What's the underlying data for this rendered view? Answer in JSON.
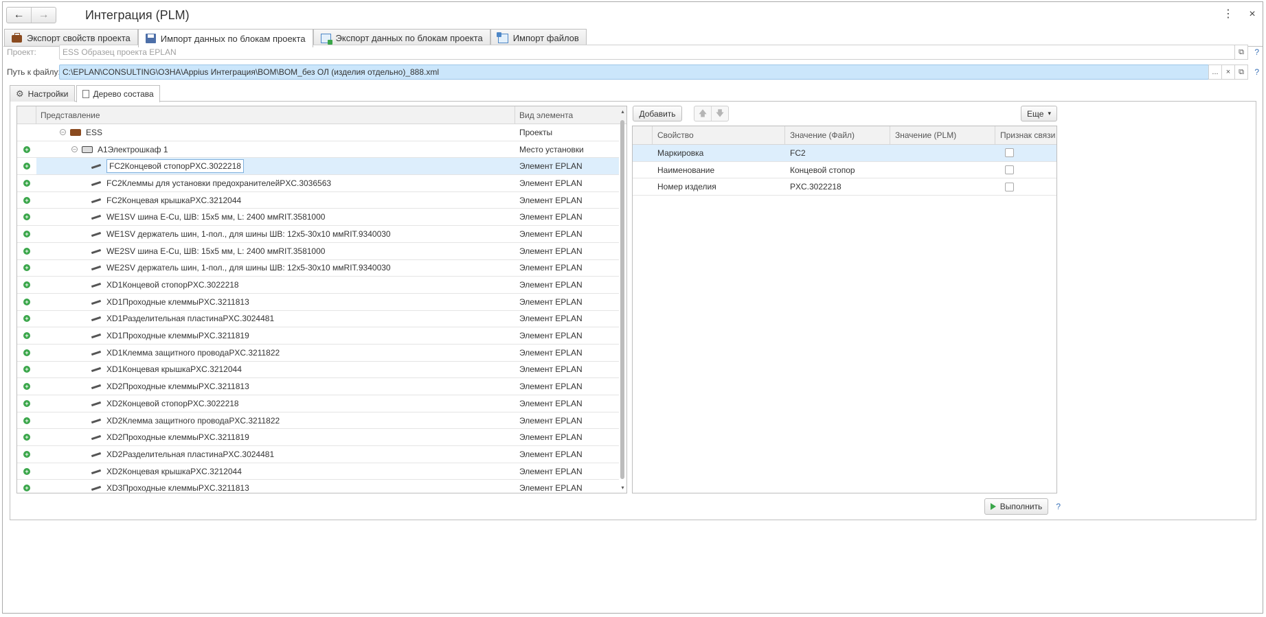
{
  "window": {
    "title": "Интеграция (PLM)",
    "nav_back": "←",
    "nav_forward": "→",
    "menu_glyph": "⋮",
    "close_glyph": "×"
  },
  "top_tabs": [
    {
      "label": "Экспорт свойств проекта",
      "icon": "briefcase-icon"
    },
    {
      "label": "Импорт данных по блокам проекта",
      "icon": "disk-icon",
      "active": true
    },
    {
      "label": "Экспорт данных по блокам проекта",
      "icon": "export-icon"
    },
    {
      "label": "Импорт файлов",
      "icon": "import-icon"
    }
  ],
  "fields": {
    "project": {
      "label": "Проект:",
      "value": "ESS Образец проекта EPLAN"
    },
    "path": {
      "label": "Путь к файлу:",
      "value": "C:\\EPLAN\\CONSULTING\\ОЗНА\\Appius Интеграция\\BOM\\BOM_без ОЛ (изделия отдельно)_888.xml"
    },
    "help": "?",
    "ellipsis": "...",
    "clear": "×",
    "open": "⧉"
  },
  "inner_tabs": [
    {
      "label": "Настройки",
      "icon": "gear-icon"
    },
    {
      "label": "Дерево состава",
      "icon": "tree-icon",
      "active": true
    }
  ],
  "tree": {
    "headers": {
      "presentation": "Представление",
      "type": "Вид элемента"
    },
    "rows": [
      {
        "level": 0,
        "toggle": "minus",
        "plus": false,
        "icon": "briefcase",
        "text": "ESS",
        "type": "Проекты"
      },
      {
        "level": 1,
        "toggle": "minus",
        "plus": true,
        "icon": "cabinet",
        "text": "A1Электрошкаф 1",
        "type": "Место установки"
      },
      {
        "level": 2,
        "plus": true,
        "icon": "element",
        "text": "FC2Концевой стопорPXC.3022218",
        "type": "Элемент EPLAN",
        "selected": true
      },
      {
        "level": 2,
        "plus": true,
        "icon": "element",
        "text": "FC2Клеммы для установки предохранителейPXC.3036563",
        "type": "Элемент EPLAN"
      },
      {
        "level": 2,
        "plus": true,
        "icon": "element",
        "text": "FC2Концевая крышкаPXC.3212044",
        "type": "Элемент EPLAN"
      },
      {
        "level": 2,
        "plus": true,
        "icon": "element",
        "text": "WE1SV шина E-Cu, ШВ: 15x5 мм, L: 2400 ммRIT.3581000",
        "type": "Элемент EPLAN"
      },
      {
        "level": 2,
        "plus": true,
        "icon": "element",
        "text": "WE1SV держатель шин, 1-пол., для шины ШВ: 12x5-30x10 ммRIT.9340030",
        "type": "Элемент EPLAN"
      },
      {
        "level": 2,
        "plus": true,
        "icon": "element",
        "text": "WE2SV шина E-Cu, ШВ: 15x5 мм, L: 2400 ммRIT.3581000",
        "type": "Элемент EPLAN"
      },
      {
        "level": 2,
        "plus": true,
        "icon": "element",
        "text": "WE2SV держатель шин, 1-пол., для шины ШВ: 12x5-30x10 ммRIT.9340030",
        "type": "Элемент EPLAN"
      },
      {
        "level": 2,
        "plus": true,
        "icon": "element",
        "text": "XD1Концевой стопорPXC.3022218",
        "type": "Элемент EPLAN"
      },
      {
        "level": 2,
        "plus": true,
        "icon": "element",
        "text": "XD1Проходные клеммыPXC.3211813",
        "type": "Элемент EPLAN"
      },
      {
        "level": 2,
        "plus": true,
        "icon": "element",
        "text": "XD1Разделительная пластинаPXC.3024481",
        "type": "Элемент EPLAN"
      },
      {
        "level": 2,
        "plus": true,
        "icon": "element",
        "text": "XD1Проходные клеммыPXC.3211819",
        "type": "Элемент EPLAN"
      },
      {
        "level": 2,
        "plus": true,
        "icon": "element",
        "text": "XD1Клемма защитного проводаPXC.3211822",
        "type": "Элемент EPLAN"
      },
      {
        "level": 2,
        "plus": true,
        "icon": "element",
        "text": "XD1Концевая крышкаPXC.3212044",
        "type": "Элемент EPLAN"
      },
      {
        "level": 2,
        "plus": true,
        "icon": "element",
        "text": "XD2Проходные клеммыPXC.3211813",
        "type": "Элемент EPLAN"
      },
      {
        "level": 2,
        "plus": true,
        "icon": "element",
        "text": "XD2Концевой стопорPXC.3022218",
        "type": "Элемент EPLAN"
      },
      {
        "level": 2,
        "plus": true,
        "icon": "element",
        "text": "XD2Клемма защитного проводаPXC.3211822",
        "type": "Элемент EPLAN"
      },
      {
        "level": 2,
        "plus": true,
        "icon": "element",
        "text": "XD2Проходные клеммыPXC.3211819",
        "type": "Элемент EPLAN"
      },
      {
        "level": 2,
        "plus": true,
        "icon": "element",
        "text": "XD2Разделительная пластинаPXC.3024481",
        "type": "Элемент EPLAN"
      },
      {
        "level": 2,
        "plus": true,
        "icon": "element",
        "text": "XD2Концевая крышкаPXC.3212044",
        "type": "Элемент EPLAN"
      },
      {
        "level": 2,
        "plus": true,
        "icon": "element",
        "text": "XD3Проходные клеммыPXC.3211813",
        "type": "Элемент EPLAN"
      }
    ]
  },
  "right": {
    "add_label": "Добавить",
    "up_glyph": "🡅",
    "down_glyph": "🡇",
    "more_label": "Еще",
    "more_caret": "▾",
    "headers": {
      "property": "Свойство",
      "value_file": "Значение (Файл)",
      "value_plm": "Значение (PLM)",
      "link": "Признак связи"
    },
    "rows": [
      {
        "property": "Маркировка",
        "value_file": "FC2",
        "value_plm": "",
        "linked": false,
        "selected": true
      },
      {
        "property": "Наименование",
        "value_file": "Концевой стопор",
        "value_plm": "",
        "linked": false
      },
      {
        "property": "Номер изделия",
        "value_file": "PXC.3022218",
        "value_plm": "",
        "linked": false
      }
    ]
  },
  "run_label": "Выполнить",
  "colors": {
    "accent_green": "#3aa64a",
    "selection": "#ddeefc",
    "path_highlight": "#cbe6fb"
  }
}
